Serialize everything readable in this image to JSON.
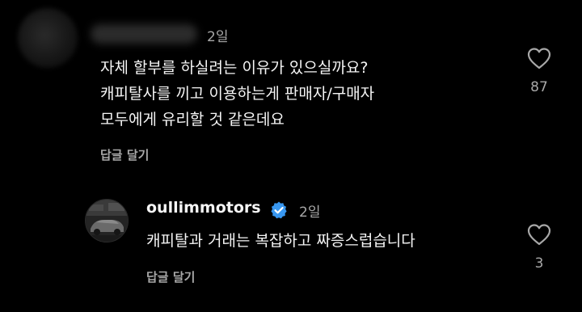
{
  "comments": [
    {
      "time": "2일",
      "lines": [
        "자체 할부를 하실려는 이유가 있으실까요?",
        "캐피탈사를 끼고 이용하는게 판매자/구매자",
        "모두에게 유리할 것 같은데요"
      ],
      "reply_label": "답글 달기",
      "likes": "87"
    },
    {
      "username": "oullimmotors",
      "time": "2일",
      "lines": [
        "캐피탈과 거래는 복잡하고 짜증스럽습니다"
      ],
      "reply_label": "답글 달기",
      "likes": "3"
    }
  ],
  "colors": {
    "background": "#000000",
    "text": "#f5f5f5",
    "muted": "#a8a8a8",
    "verified": "#3897f0"
  },
  "icons": [
    "heart-icon",
    "verified-badge-icon"
  ]
}
